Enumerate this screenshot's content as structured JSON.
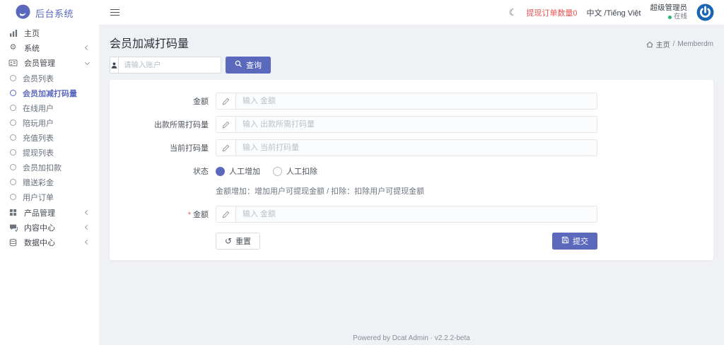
{
  "colors": {
    "primary": "#5b69bd",
    "danger": "#ea5455",
    "online_green": "#22b573",
    "avatar_blue": "#1a66b5"
  },
  "brand": {
    "name": "后台系统"
  },
  "sidebar": {
    "items": [
      {
        "label": "主页"
      },
      {
        "label": "系统"
      },
      {
        "label": "会员管理"
      },
      {
        "label": "产品管理"
      },
      {
        "label": "内容中心"
      },
      {
        "label": "数据中心"
      }
    ],
    "member_children": [
      {
        "label": "会员列表"
      },
      {
        "label": "会员加减打码量",
        "active": true
      },
      {
        "label": "在线用户"
      },
      {
        "label": "陪玩用户"
      },
      {
        "label": "充值列表"
      },
      {
        "label": "提现列表"
      },
      {
        "label": "会员加扣款"
      },
      {
        "label": "赠送彩金"
      },
      {
        "label": "用户订单"
      }
    ]
  },
  "header": {
    "withdraw_orders": "提现订单数量0",
    "language": "中文 /Tiếng Việt",
    "user_role": "超级管理员",
    "online_status": "在线"
  },
  "icons": {
    "gear": "⚙",
    "moon": "☾",
    "reset": "↺"
  },
  "page": {
    "title": "会员加减打码量",
    "breadcrumb_home": "主页",
    "breadcrumb_separator": "/",
    "breadcrumb_current": "Memberdm"
  },
  "search": {
    "placeholder": "请输入账户",
    "button_label": "查询"
  },
  "form": {
    "rows": [
      {
        "label": "金额",
        "placeholder": "输入 金额"
      },
      {
        "label": "出款所需打码量",
        "placeholder": "输入 出款所需打码量"
      },
      {
        "label": "当前打码量",
        "placeholder": "输入 当前打码量"
      }
    ],
    "status": {
      "label": "状态",
      "options": [
        {
          "label": "人工增加",
          "selected": true
        },
        {
          "label": "人工扣除",
          "selected": false
        }
      ],
      "help": "金额增加：增加用户可提现金额 / 扣除：扣除用户可提现金额"
    },
    "required_amount": {
      "mark": "*",
      "label": "金额",
      "placeholder": "输入 金额"
    },
    "reset_label": "重置",
    "submit_label": "提交"
  },
  "footer": {
    "text": "Powered by Dcat Admin · v2.2.2-beta"
  }
}
